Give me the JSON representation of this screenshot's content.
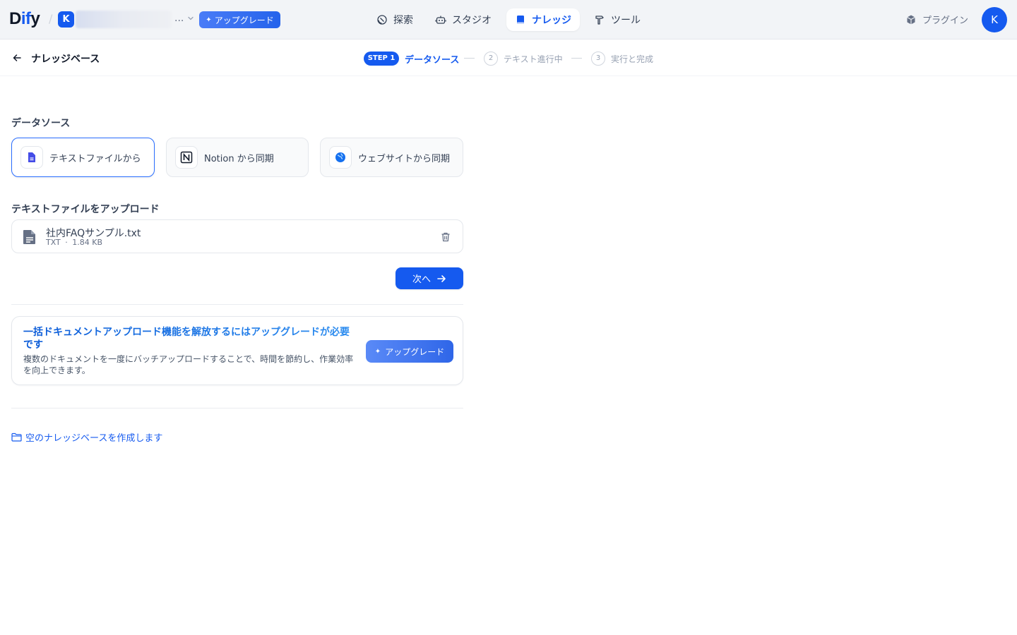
{
  "header": {
    "logo": {
      "prefix": "D",
      "middle": "if",
      "suffix": "y"
    },
    "workspace": {
      "initial": "K",
      "ellipsis": "..."
    },
    "upgrade_label": "アップグレード",
    "nav": [
      {
        "label": "探索",
        "icon": "compass-icon"
      },
      {
        "label": "スタジオ",
        "icon": "robot-icon"
      },
      {
        "label": "ナレッジ",
        "icon": "book-icon",
        "active": true
      },
      {
        "label": "ツール",
        "icon": "hammer-icon"
      }
    ],
    "plugin_label": "プラグイン",
    "user_initial": "K"
  },
  "stepbar": {
    "back_title": "ナレッジベース",
    "steps": [
      {
        "badge": "STEP 1",
        "label": "データソース",
        "active": true
      },
      {
        "num": "2",
        "label": "テキスト進行中"
      },
      {
        "num": "3",
        "label": "実行と完成"
      }
    ]
  },
  "datasource": {
    "title": "データソース",
    "options": [
      {
        "label": "テキストファイルから",
        "icon": "document-icon",
        "selected": true
      },
      {
        "label": "Notion から同期",
        "icon": "notion-icon"
      },
      {
        "label": "ウェブサイトから同期",
        "icon": "globe-icon"
      }
    ]
  },
  "upload": {
    "title": "テキストファイルをアップロード",
    "file": {
      "name": "社内FAQサンプル.txt",
      "type": "TXT",
      "sep": "·",
      "size": "1.84 KB"
    }
  },
  "next_label": "次へ",
  "promo": {
    "title": "一括ドキュメントアップロード機能を解放するにはアップグレードが必要です",
    "description": "複数のドキュメントを一度にバッチアップロードすることで、時間を節約し、作業効率を向上できます。",
    "button_label": "アップグレード"
  },
  "empty_kb_label": "空のナレッジベースを作成します",
  "colors": {
    "accent": "#155aef",
    "border": "#e4e7ec",
    "muted": "#98a2b3"
  }
}
